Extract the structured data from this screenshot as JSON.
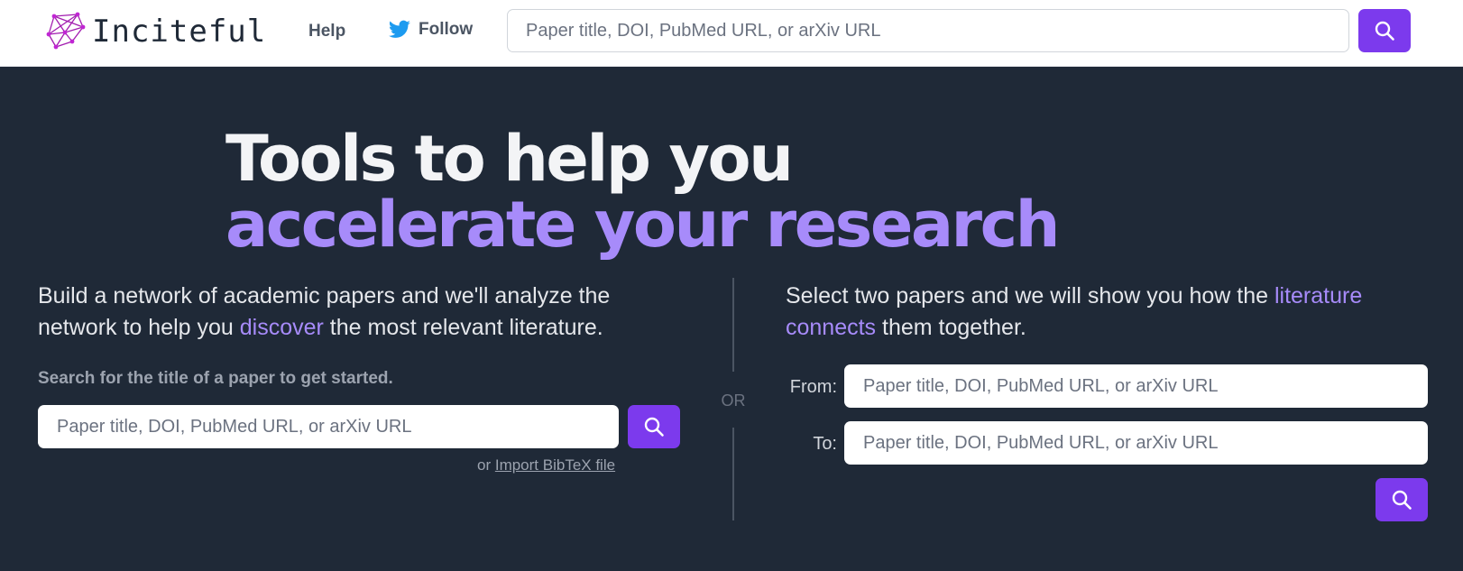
{
  "nav": {
    "brand": "Inciteful",
    "help": "Help",
    "follow": "Follow",
    "search_placeholder": "Paper title, DOI, PubMed URL, or arXiv URL"
  },
  "hero": {
    "line1": "Tools to help you",
    "line2": "accelerate your research"
  },
  "left": {
    "desc_part1": "Build a network of academic papers and we'll analyze the network to help you ",
    "desc_highlight": "discover",
    "desc_part2": " the most relevant literature.",
    "hint": "Search for the title of a paper to get started.",
    "search_placeholder": "Paper title, DOI, PubMed URL, or arXiv URL",
    "import_prefix": "or ",
    "import_link": "Import BibTeX file"
  },
  "divider": {
    "or": "OR"
  },
  "right": {
    "desc_part1": "Select two papers and we will show you how the ",
    "desc_highlight": "literature connects",
    "desc_part2": " them together.",
    "from_label": "From:",
    "to_label": "To:",
    "from_placeholder": "Paper title, DOI, PubMed URL, or arXiv URL",
    "to_placeholder": "Paper title, DOI, PubMed URL, or arXiv URL"
  },
  "icons": {
    "logo": "network-graph-icon",
    "follow": "twitter-bird-icon",
    "search": "magnifier-icon"
  },
  "colors": {
    "accent": "#7c3aed",
    "highlight": "#a78bfa",
    "background": "#1f2937",
    "twitter": "#1d9bf0"
  }
}
